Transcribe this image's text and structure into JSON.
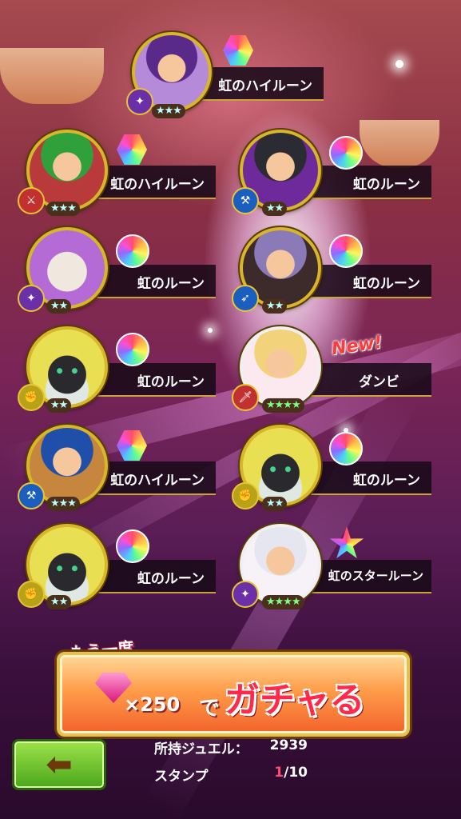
{
  "results": [
    {
      "item": "虹のハイルーン",
      "rarity": "★★★",
      "type_icon": "staff-icon",
      "rune": "high",
      "avatar": "sorceress"
    },
    {
      "item": "虹のハイルーン",
      "rarity": "★★★",
      "type_icon": "sword-icon",
      "rune": "high",
      "avatar": "green-hair-hero"
    },
    {
      "item": "虹のルーン",
      "rarity": "★★",
      "type_icon": "axe-icon",
      "rune": "normal",
      "avatar": "dark-knight"
    },
    {
      "item": "虹のルーン",
      "rarity": "★★",
      "type_icon": "staff-icon",
      "rune": "normal",
      "avatar": "cat-spirit"
    },
    {
      "item": "虹のルーン",
      "rarity": "★★",
      "type_icon": "spear-icon",
      "rune": "normal",
      "avatar": "purple-hair-elf"
    },
    {
      "item": "虹のルーン",
      "rarity": "★★",
      "type_icon": "fist-icon",
      "rune": "normal",
      "avatar": "black-cat"
    },
    {
      "item": "ダンビ",
      "rarity": "★★★★",
      "type_icon": "dagger-icon",
      "rune": "none",
      "avatar": "flower-girl",
      "badge": "New!"
    },
    {
      "item": "虹のハイルーン",
      "rarity": "★★★",
      "type_icon": "axe-icon",
      "rune": "high",
      "avatar": "goggle-girl"
    },
    {
      "item": "虹のルーン",
      "rarity": "★★",
      "type_icon": "fist-icon",
      "rune": "normal",
      "avatar": "black-cat"
    },
    {
      "item": "虹のルーン",
      "rarity": "★★",
      "type_icon": "fist-icon",
      "rune": "normal",
      "avatar": "black-cat"
    },
    {
      "item": "虹のスタールーン",
      "rarity": "★★★★",
      "type_icon": "staff-icon",
      "rune": "star",
      "avatar": "white-hair-mage"
    }
  ],
  "gacha": {
    "again_label": "もう一度",
    "cost": "×250",
    "cost_unit": "で",
    "title": "ガチャる",
    "gem_icon": "jewel-icon"
  },
  "footer": {
    "jewel_label": "所持ジュエル：",
    "jewel_value": "2939",
    "stamp_label": "スタンプ",
    "stamp_current": "1",
    "stamp_total": "/10"
  },
  "colors": {
    "accent": "#d8b62c",
    "button": "#f2622a",
    "back": "#4aa61b"
  }
}
